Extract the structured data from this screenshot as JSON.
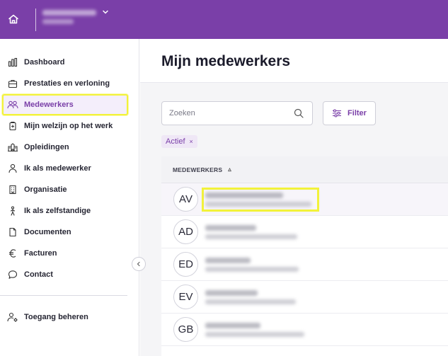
{
  "sidebar": {
    "items": [
      {
        "label": "Dashboard",
        "icon": "bar-chart-icon"
      },
      {
        "label": "Prestaties en verloning",
        "icon": "briefcase-icon"
      },
      {
        "label": "Medewerkers",
        "icon": "people-icon",
        "active": true
      },
      {
        "label": "Mijn welzijn op het werk",
        "icon": "first-aid-kit-icon"
      },
      {
        "label": "Opleidingen",
        "icon": "school-building-icon"
      },
      {
        "label": "Ik als medewerker",
        "icon": "person-icon"
      },
      {
        "label": "Organisatie",
        "icon": "building-icon"
      },
      {
        "label": "Ik als zelfstandige",
        "icon": "walking-person-icon"
      },
      {
        "label": "Documenten",
        "icon": "document-icon"
      },
      {
        "label": "Facturen",
        "icon": "euro-icon"
      },
      {
        "label": "Contact",
        "icon": "chat-bubble-icon"
      }
    ],
    "footer_item": {
      "label": "Toegang beheren",
      "icon": "user-settings-icon"
    }
  },
  "main": {
    "title": "Mijn medewerkers",
    "search": {
      "placeholder": "Zoeken",
      "value": ""
    },
    "filter_label": "Filter",
    "active_chip": {
      "label": "Actief",
      "remove_glyph": "×"
    },
    "table": {
      "column_header": "MEDEWERKERS",
      "sort_glyph": "▵",
      "rows": [
        {
          "initials": "AV"
        },
        {
          "initials": "AD"
        },
        {
          "initials": "ED"
        },
        {
          "initials": "EV"
        },
        {
          "initials": "GB"
        }
      ]
    }
  },
  "colors": {
    "brand": "#7a3fa8",
    "highlight": "#f2f23a",
    "active_bg": "#f4eefb"
  }
}
